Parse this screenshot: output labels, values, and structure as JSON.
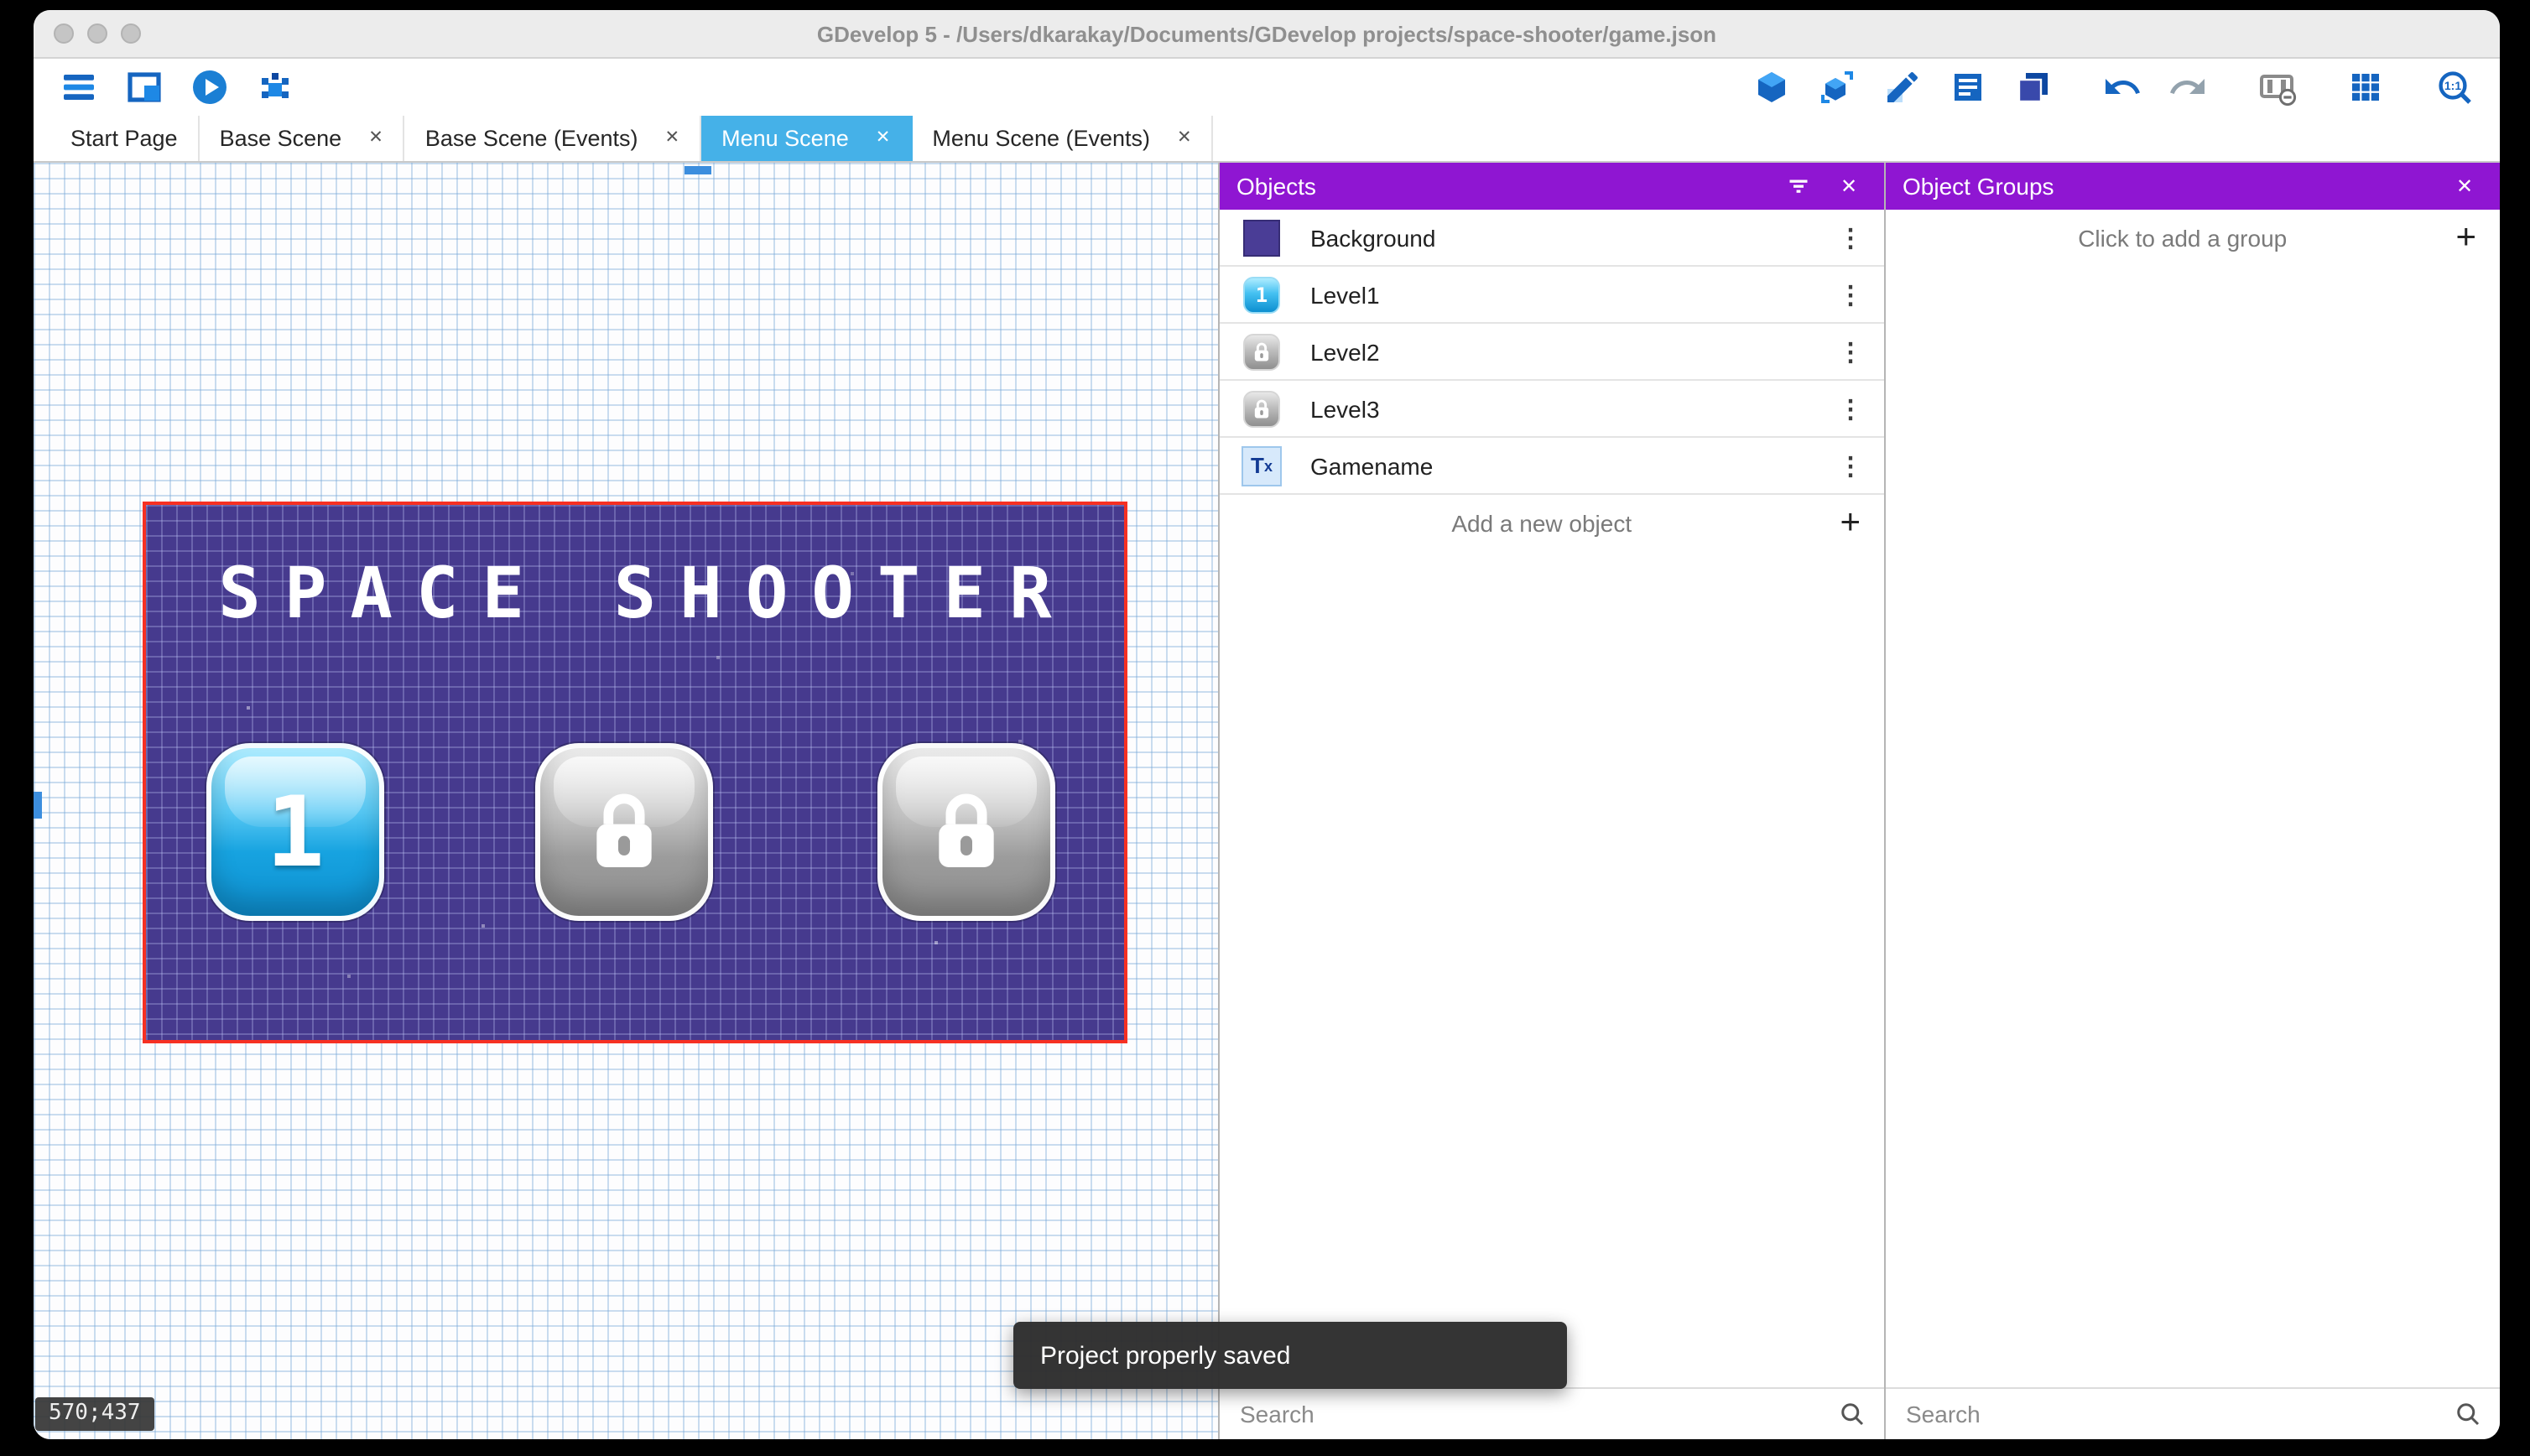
{
  "window": {
    "title": "GDevelop 5 - /Users/dkarakay/Documents/GDevelop projects/space-shooter/game.json"
  },
  "toolbar": {
    "left_icons": [
      "project-manager",
      "scene-editor",
      "start-preview",
      "debug"
    ],
    "right_icons": [
      "objects-editor",
      "object-groups-editor",
      "properties",
      "instances-list",
      "layers",
      "undo",
      "redo",
      "preview-options",
      "toggle-grid",
      "zoom-one-to-one"
    ]
  },
  "tabs": [
    {
      "label": "Start Page",
      "active": false,
      "closable": false
    },
    {
      "label": "Base Scene",
      "active": false,
      "closable": true
    },
    {
      "label": "Base Scene (Events)",
      "active": false,
      "closable": true
    },
    {
      "label": "Menu Scene",
      "active": true,
      "closable": true
    },
    {
      "label": "Menu Scene (Events)",
      "active": false,
      "closable": true
    }
  ],
  "canvas": {
    "coordinates_badge": "570;437",
    "scene": {
      "title": "SPACE SHOOTER",
      "level_buttons": [
        {
          "label": "1",
          "state": "unlocked"
        },
        {
          "label": "",
          "state": "locked"
        },
        {
          "label": "",
          "state": "locked"
        }
      ]
    }
  },
  "objects_panel": {
    "title": "Objects",
    "items": [
      {
        "name": "Background",
        "icon": "background-swatch-icon"
      },
      {
        "name": "Level1",
        "icon": "level1-button-icon"
      },
      {
        "name": "Level2",
        "icon": "locked-button-icon"
      },
      {
        "name": "Level3",
        "icon": "locked-button-icon"
      },
      {
        "name": "Gamename",
        "icon": "text-object-icon"
      }
    ],
    "add_button": "Add a new object",
    "search": {
      "placeholder": "Search",
      "value": ""
    }
  },
  "object_groups_panel": {
    "title": "Object Groups",
    "add_button": "Click to add a group",
    "search": {
      "placeholder": "Search",
      "value": ""
    }
  },
  "snackbar": "Project properly saved",
  "glyphs": {
    "close": "✕",
    "kebab": "⋮",
    "plus": "+",
    "zoom_label": "1:1",
    "text_icon": "T",
    "text_icon_sub": "x"
  },
  "colors": {
    "panel_header_purple": "#8f16d2",
    "active_tab_blue": "#45b1e8",
    "selection_red": "#f63022",
    "scene_background_purple": "#463a8e",
    "toolbar_icon_blue": "#1565c0"
  }
}
